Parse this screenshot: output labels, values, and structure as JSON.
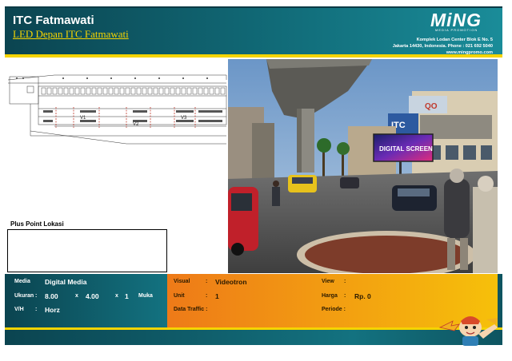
{
  "header": {
    "title": "ITC Fatmawati",
    "subtitle": "LED Depan ITC Fatmawati",
    "logo_word": "MiNG",
    "logo_tag": "MEDIA PROMOTION",
    "address_line1": "Komplek Lodan Center Blok E No. 5",
    "address_line2": "Jakarta 14430, Indonesia. Phone : 021 692 5040",
    "address_line3": "www.mingpromo.com"
  },
  "map": {
    "labels": [
      "V1",
      "V2",
      "V3"
    ]
  },
  "photo": {
    "screen_text": "DIGITAL SCREEN",
    "store_sign": "ITC",
    "top_sign": "QO"
  },
  "plus_point": {
    "label": "Plus Point Lokasi",
    "content": ""
  },
  "info": {
    "media_label": "Media",
    "media_value": "Digital Media",
    "ukuran_label": "Ukuran :",
    "width": "8.00",
    "x1": "x",
    "height": "4.00",
    "x2": "x",
    "muka_count": "1",
    "muka_label": "Muka",
    "vh_label": "V/H",
    "vh_value": "Horz",
    "visual_label": "Visual",
    "visual_value": "Videotron",
    "unit_label": "Unit",
    "unit_value": "1",
    "traffic_label": "Data Traffic :",
    "view_label": "View",
    "view_value": "",
    "harga_label": "Harga",
    "harga_value": "Rp. 0",
    "periode_label": "Periode :",
    "colon": ":"
  },
  "colors": {
    "teal": "#0b4450",
    "teal_light": "#1a8c99",
    "yellow": "#f5d400",
    "orange": "#ee7a18"
  }
}
